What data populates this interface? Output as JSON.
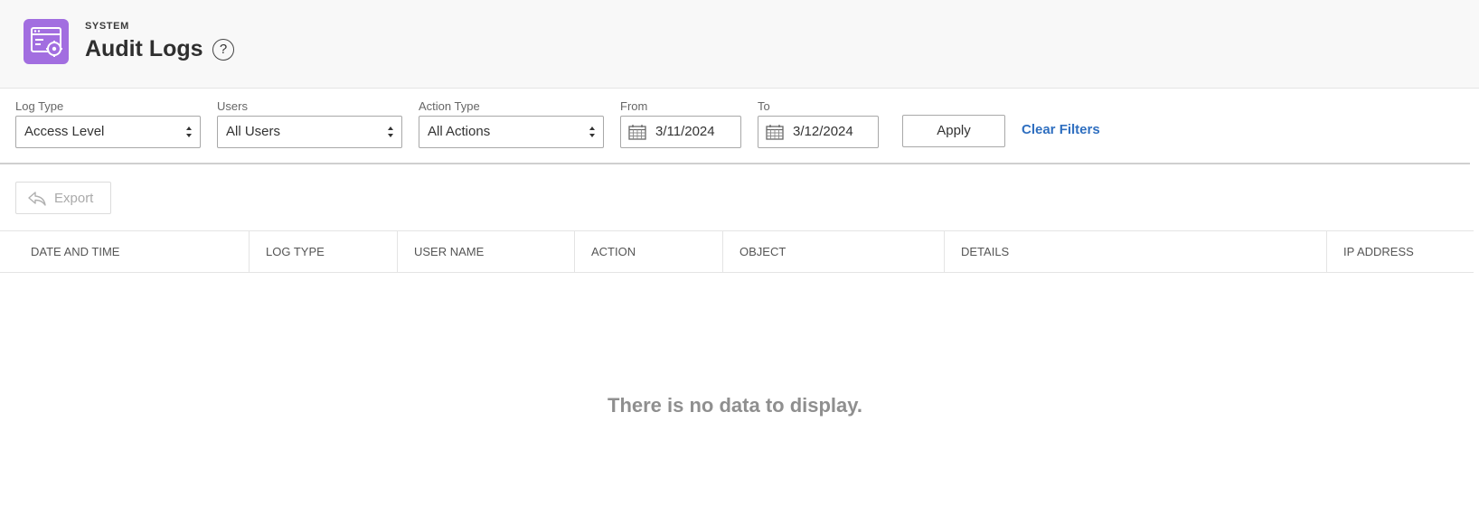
{
  "header": {
    "eyebrow": "SYSTEM",
    "title": "Audit Logs",
    "help_glyph": "?",
    "icon": "audit-settings-icon",
    "icon_color": "#a26ee0"
  },
  "filters": {
    "log_type": {
      "label": "Log Type",
      "value": "Access Level"
    },
    "users": {
      "label": "Users",
      "value": "All Users"
    },
    "action_type": {
      "label": "Action Type",
      "value": "All Actions"
    },
    "from": {
      "label": "From",
      "value": "3/11/2024"
    },
    "to": {
      "label": "To",
      "value": "3/12/2024"
    },
    "apply_label": "Apply",
    "clear_label": "Clear Filters",
    "link_color": "#2f6fc0"
  },
  "toolbar": {
    "export_label": "Export"
  },
  "table": {
    "columns": [
      "DATE AND TIME",
      "LOG TYPE",
      "USER NAME",
      "ACTION",
      "OBJECT",
      "DETAILS",
      "IP ADDRESS"
    ],
    "rows": [],
    "empty_message": "There is no data to display."
  }
}
